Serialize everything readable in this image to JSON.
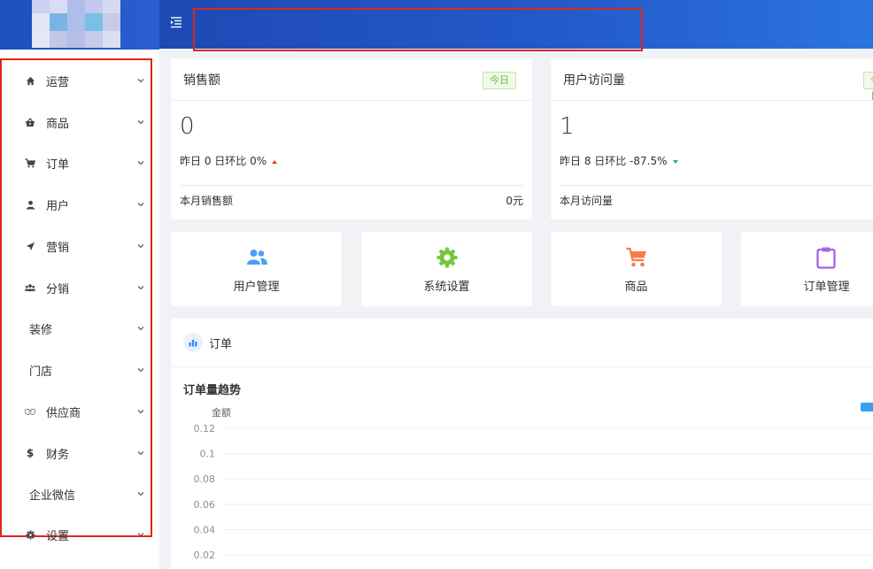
{
  "sidebar": {
    "items": [
      {
        "label": "运营",
        "icon": "home-icon"
      },
      {
        "label": "商品",
        "icon": "basket-icon"
      },
      {
        "label": "订单",
        "icon": "cart-icon"
      },
      {
        "label": "用户",
        "icon": "user-icon"
      },
      {
        "label": "营销",
        "icon": "send-icon"
      },
      {
        "label": "分销",
        "icon": "team-icon"
      },
      {
        "label": "装修",
        "icon": ""
      },
      {
        "label": "门店",
        "icon": ""
      },
      {
        "label": "供应商",
        "icon": "supplier-icon"
      },
      {
        "label": "财务",
        "icon": "dollar-icon"
      },
      {
        "label": "企业微信",
        "icon": ""
      },
      {
        "label": "设置",
        "icon": "gear-icon"
      }
    ]
  },
  "stats": {
    "sales": {
      "title": "销售额",
      "tag": "今日",
      "value": "0",
      "compare_text": "昨日 0  日环比 0%",
      "trend": "up",
      "foot_label": "本月销售额",
      "foot_value": "0元"
    },
    "visits": {
      "title": "用户访问量",
      "tag": "今日",
      "value": "1",
      "compare_text": "昨日 8  日环比 -87.5%",
      "trend": "down",
      "foot_label": "本月访问量"
    }
  },
  "quick_links": [
    {
      "label": "用户管理",
      "icon": "users-icon",
      "color": "#4a9ff5"
    },
    {
      "label": "系统设置",
      "icon": "gear-icon",
      "color": "#74c73a"
    },
    {
      "label": "商品",
      "icon": "cart-icon",
      "color": "#f57c4a"
    },
    {
      "label": "订单管理",
      "icon": "clipboard-icon",
      "color": "#a463e8"
    }
  ],
  "order_panel": {
    "title": "订单",
    "chart_title": "订单量趋势"
  },
  "chart_data": {
    "type": "line",
    "title": "订单量趋势",
    "ylabel": "金额",
    "y_ticks": [
      "0.12",
      "0.1",
      "0.08",
      "0.06",
      "0.04",
      "0.02"
    ],
    "ylim": [
      0,
      0.12
    ],
    "grid": true,
    "legend": "top-right",
    "series": []
  },
  "colors": {
    "header_start": "#1e49b4",
    "header_end": "#2b74e0",
    "highlight_box": "#e0261a",
    "tag_green": "#67c23a",
    "trend_up": "#ed4014",
    "trend_down": "#19be6b"
  }
}
